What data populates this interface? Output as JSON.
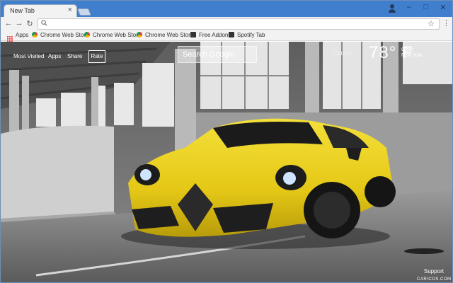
{
  "browser": {
    "tab_title": "New Tab",
    "tab_close": "×",
    "window_controls": {
      "minimize": "–",
      "maximize": "□",
      "close": "✕"
    },
    "icons": {
      "back": "back-arrow-icon",
      "forward": "forward-arrow-icon",
      "reload": "reload-icon",
      "star": "star-icon",
      "menu": "kebab-menu-icon"
    },
    "omnibox": {
      "value": "",
      "placeholder": ""
    },
    "bookmarks": [
      {
        "label": "Apps",
        "icon": "apps-grid-icon"
      },
      {
        "label": "Chrome Web Store",
        "icon": "chrome-web-store-icon"
      },
      {
        "label": "Chrome Web Store",
        "icon": "chrome-web-store-icon"
      },
      {
        "label": "Chrome Web Store",
        "icon": "chrome-web-store-icon"
      },
      {
        "label": "Free Addons",
        "icon": "tv-icon"
      },
      {
        "label": "Spotify Tab",
        "icon": "tv-icon"
      }
    ],
    "colors": {
      "titlebar": "#3f7fce",
      "toolbar": "#f2f2f2"
    }
  },
  "newtab": {
    "nav": {
      "most_visited": "Most Visited",
      "apps": "Apps",
      "share": "Share",
      "rate": "Rate"
    },
    "search": {
      "placeholder": "Search Google",
      "value": ""
    },
    "options": "Options",
    "weather": {
      "temperature": "78° F",
      "condition": "Clear",
      "location": "New York"
    },
    "support": "Support",
    "credit": "CARICOS.COM",
    "background": "yellow-alfa-romeo-4c-spider-in-parking-garage"
  }
}
